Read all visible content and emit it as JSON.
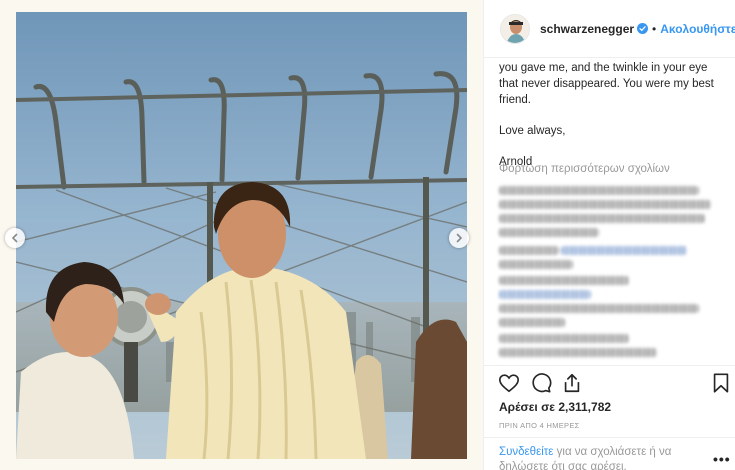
{
  "header": {
    "username": "schwarzenegger",
    "separator": "•",
    "follow_label": "Ακολουθήστε"
  },
  "caption": {
    "paragraph1": "you gave me, and the twinkle in your eye that never disappeared. You were my best friend.",
    "paragraph2": "Love always,",
    "signature": "Arnold"
  },
  "comments": {
    "load_more_label": "Φόρτωση περισσότερων σχολίων"
  },
  "actions": {
    "like_icon": "heart-icon",
    "comment_icon": "comment-icon",
    "share_icon": "share-icon",
    "save_icon": "bookmark-icon"
  },
  "stats": {
    "likes_text": "Αρέσει σε 2,311,782",
    "timestamp": "ΠΡΙΝ ΑΠΟ 4 ΗΜΕΡΕΣ"
  },
  "footer": {
    "login_link": "Συνδεθείτε",
    "login_text": " για να σχολιάσετε ή να δηλώσετε ότι σας αρέσει.",
    "more_label": "•••"
  },
  "colors": {
    "link_blue": "#3897f0",
    "text_dark": "#262626",
    "text_muted": "#999999",
    "border": "#efefef"
  }
}
